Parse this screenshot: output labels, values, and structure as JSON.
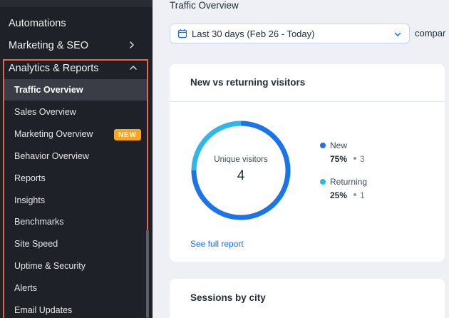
{
  "sidebar": {
    "top_items": [
      {
        "label": "Automations"
      },
      {
        "label": "Marketing & SEO"
      }
    ],
    "group": {
      "label": "Analytics & Reports",
      "items": [
        {
          "label": "Traffic Overview",
          "active": true
        },
        {
          "label": "Sales Overview"
        },
        {
          "label": "Marketing Overview",
          "badge": "NEW"
        },
        {
          "label": "Behavior Overview"
        },
        {
          "label": "Reports"
        },
        {
          "label": "Insights"
        },
        {
          "label": "Benchmarks"
        },
        {
          "label": "Site Speed"
        },
        {
          "label": "Uptime & Security"
        },
        {
          "label": "Alerts"
        },
        {
          "label": "Email Updates"
        }
      ]
    },
    "highlight_color": "#e8664d"
  },
  "main": {
    "title": "Traffic Overview",
    "date_range": "Last 30 days (Feb 26 - Today)",
    "compare_label": "compar",
    "visitors_card": {
      "title": "New vs returning visitors",
      "center_label": "Unique visitors",
      "center_value": "4",
      "legend": [
        {
          "name": "New",
          "pct": "75%",
          "count": "3",
          "color": "#1b75e8",
          "share": 0.75
        },
        {
          "name": "Returning",
          "pct": "25%",
          "count": "1",
          "color": "#2cb7f0",
          "share": 0.25
        }
      ],
      "link": "See full report"
    },
    "sessions_card": {
      "title": "Sessions by city"
    }
  }
}
